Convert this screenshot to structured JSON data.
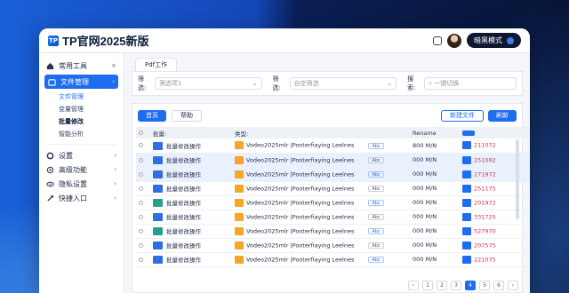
{
  "app": {
    "title": "TP官网2025新版",
    "logo": "TP",
    "dark_mode_label": "暗黑模式"
  },
  "sidebar": {
    "sections": [
      {
        "label": "常用工具",
        "icon": "home-icon",
        "chevron": "×"
      },
      {
        "label": "文件管理",
        "icon": "folder-icon",
        "chevron": "›",
        "active": true
      }
    ],
    "sub_items": [
      "文件管理",
      "变量管理",
      "批量修改",
      "智能分析"
    ],
    "items": [
      {
        "label": "设置",
        "icon": "gear-icon"
      },
      {
        "label": "高级功能",
        "icon": "link-icon"
      },
      {
        "label": "隐私设置",
        "icon": "eye-icon"
      },
      {
        "label": "快捷入口",
        "icon": "tools-icon"
      }
    ]
  },
  "tab": {
    "label": "Pdf工作"
  },
  "filters": {
    "f1_label": "筛选:",
    "f1_value": "筛选项1",
    "f2_label": "筛选:",
    "f2_value": "自定筛选",
    "search_label": "搜索:",
    "search_placeholder": "一键切换"
  },
  "buttons": {
    "b1": "首页",
    "b2": "帮助",
    "b3": "新建文件",
    "b4": "刷新"
  },
  "table": {
    "headers": [
      "批量:",
      "",
      "类型:",
      "",
      "",
      "Rename",
      "",
      "操作"
    ],
    "rows": [
      {
        "name": "批量修改操作",
        "file": "Vodeo2025mlr |Pooterfiaying Leelnes",
        "tag": "Abc",
        "size": "800 M/N",
        "id": "211072",
        "icon_color": "#2f6fe0",
        "sel": false
      },
      {
        "name": "批量修改操作",
        "file": "Vodeo2025mlr |Pooterfiaying Leelnes",
        "tag": "Abc",
        "size": "000 M/N",
        "id": "251092",
        "icon_color": "#2f6fe0",
        "sel": true
      },
      {
        "name": "批量修改操作",
        "file": "Vodeo2025mlr |Pooterfiaying Leelnes",
        "tag": "Abc",
        "size": "000 M/N",
        "id": "271972",
        "icon_color": "#2f6fe0",
        "sel": true
      },
      {
        "name": "批量修改操作",
        "file": "Vodeo2025mlr |Pooterfiaying Leelnes",
        "tag": "Abc",
        "size": "000 M/N",
        "id": "251175",
        "icon_color": "#2f6fe0",
        "sel": false
      },
      {
        "name": "批量修改操作",
        "file": "Vodeo2025mlr |Pooterfiaying Leelnes",
        "tag": "Abc",
        "size": "000 M/N",
        "id": "201972",
        "icon_color": "#2a9d8f",
        "sel": false
      },
      {
        "name": "批量修改操作",
        "file": "Vodeo2025mlr |Pooterfiaying Leelnes",
        "tag": "Abc",
        "size": "000 M/N",
        "id": "331725",
        "icon_color": "#2f6fe0",
        "sel": false
      },
      {
        "name": "批量修改操作",
        "file": "Vodeo2025mlr |Pooterfiaying Leelnes",
        "tag": "Abc",
        "size": "000 M/N",
        "id": "527970",
        "icon_color": "#2a9d8f",
        "sel": false
      },
      {
        "name": "批量修改操作",
        "file": "Vodeo2025mlr |Pooterfiaying Leelnes",
        "tag": "Abc",
        "size": "000 M/N",
        "id": "207575",
        "icon_color": "#2f6fe0",
        "sel": false
      },
      {
        "name": "批量修改操作",
        "file": "Vodeo2025mlr |Pooterfiaying Leelnes",
        "tag": "Abc",
        "size": "000 M/N",
        "id": "221075",
        "icon_color": "#2f6fe0",
        "sel": false
      }
    ]
  },
  "pager": [
    "‹",
    "1",
    "2",
    "3",
    "4",
    "5",
    "6",
    "›"
  ],
  "colors": {
    "accent": "#1e6cf0",
    "folder": "#f5a623"
  }
}
